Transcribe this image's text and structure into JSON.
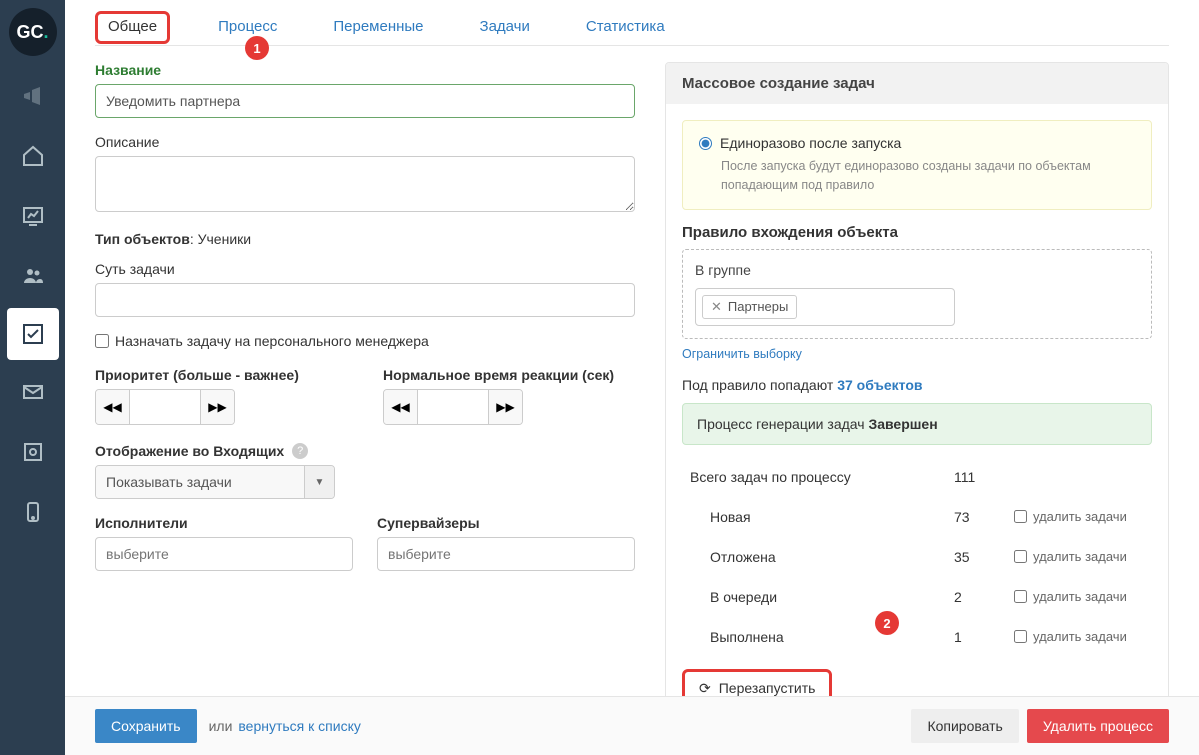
{
  "logo": {
    "text": "GC",
    "dot": "."
  },
  "tabs": {
    "general": "Общее",
    "process": "Процесс",
    "variables": "Переменные",
    "tasks": "Задачи",
    "stats": "Статистика"
  },
  "badges": {
    "one": "1",
    "two": "2"
  },
  "form": {
    "title_label": "Название",
    "title_value": "Уведомить партнера",
    "desc_label": "Описание",
    "objtype_label": "Тип объектов",
    "objtype_value": "Ученики",
    "subject_label": "Суть задачи",
    "personal_manager_label": "Назначать задачу на персонального менеджера",
    "priority_label": "Приоритет (больше - важнее)",
    "reaction_label": "Нормальное время реакции (сек)",
    "inbox_label": "Отображение во Входящих",
    "inbox_value": "Показывать задачи",
    "executors_label": "Исполнители",
    "supervisors_label": "Супервайзеры",
    "select_placeholder": "выберите"
  },
  "right": {
    "panel_title": "Массовое создание задач",
    "radio_label": "Единоразово после запуска",
    "radio_desc": "После запуска будут единоразово созданы задачи по объектам попадающим под правило",
    "rule_label": "Правило вхождения объекта",
    "in_group": "В группе",
    "tag": "Партнеры",
    "limit_link": "Ограничить выборку",
    "hits_prefix": "Под правило попадают ",
    "hits_link": "37 объектов",
    "status_prefix": "Процесс генерации задач ",
    "status_value": "Завершен",
    "total_label": "Всего задач по процессу",
    "total_value": "111",
    "rows": [
      {
        "label": "Новая",
        "value": "73"
      },
      {
        "label": "Отложена",
        "value": "35"
      },
      {
        "label": "В очереди",
        "value": "2"
      },
      {
        "label": "Выполнена",
        "value": "1"
      }
    ],
    "delete_label": "удалить задачи",
    "restart_label": "Перезапустить"
  },
  "footer": {
    "save": "Сохранить",
    "or": "или",
    "back": "вернуться к списку",
    "copy": "Копировать",
    "delete": "Удалить процесс"
  }
}
